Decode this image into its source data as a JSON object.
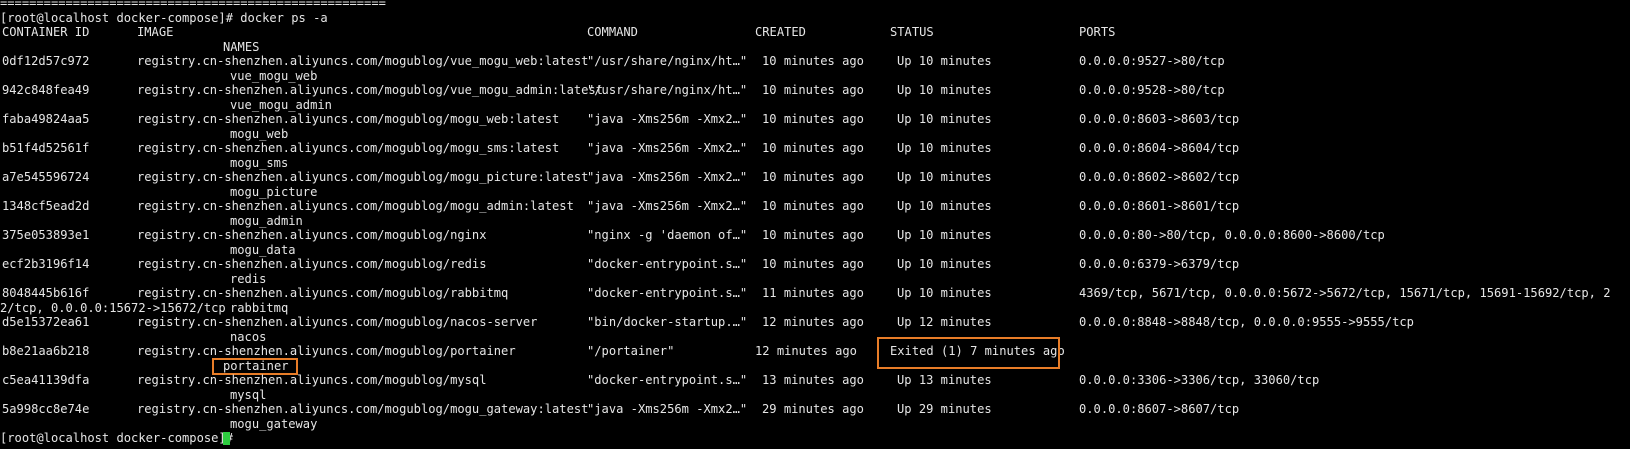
{
  "terminal": {
    "separator": "=====================================================",
    "prompt": "[root@localhost docker-compose]# docker ps -a",
    "headers": {
      "id": "CONTAINER ID",
      "image": "IMAGE",
      "command": "COMMAND",
      "created": "CREATED",
      "status": "STATUS",
      "ports": "PORTS",
      "names": "NAMES"
    },
    "rows": [
      {
        "id": "0df12d57c972",
        "image": "registry.cn-shenzhen.aliyuncs.com/mogublog/vue_mogu_web:latest",
        "command": "\"/usr/share/nginx/ht…\"",
        "created": "10 minutes ago",
        "status": "Up 10 minutes",
        "ports": "0.0.0.0:9527->80/tcp",
        "name": "vue_mogu_web"
      },
      {
        "id": "942c848fea49",
        "image": "registry.cn-shenzhen.aliyuncs.com/mogublog/vue_mogu_admin:latest",
        "command": "\"/usr/share/nginx/ht…\"",
        "created": "10 minutes ago",
        "status": "Up 10 minutes",
        "ports": "0.0.0.0:9528->80/tcp",
        "name": "vue_mogu_admin"
      },
      {
        "id": "faba49824aa5",
        "image": "registry.cn-shenzhen.aliyuncs.com/mogublog/mogu_web:latest",
        "command": "\"java -Xms256m -Xmx2…\"",
        "created": "10 minutes ago",
        "status": "Up 10 minutes",
        "ports": "0.0.0.0:8603->8603/tcp",
        "name": "mogu_web"
      },
      {
        "id": "b51f4d52561f",
        "image": "registry.cn-shenzhen.aliyuncs.com/mogublog/mogu_sms:latest",
        "command": "\"java -Xms256m -Xmx2…\"",
        "created": "10 minutes ago",
        "status": "Up 10 minutes",
        "ports": "0.0.0.0:8604->8604/tcp",
        "name": "mogu_sms"
      },
      {
        "id": "a7e545596724",
        "image": "registry.cn-shenzhen.aliyuncs.com/mogublog/mogu_picture:latest",
        "command": "\"java -Xms256m -Xmx2…\"",
        "created": "10 minutes ago",
        "status": "Up 10 minutes",
        "ports": "0.0.0.0:8602->8602/tcp",
        "name": "mogu_picture"
      },
      {
        "id": "1348cf5ead2d",
        "image": "registry.cn-shenzhen.aliyuncs.com/mogublog/mogu_admin:latest",
        "command": "\"java -Xms256m -Xmx2…\"",
        "created": "10 minutes ago",
        "status": "Up 10 minutes",
        "ports": "0.0.0.0:8601->8601/tcp",
        "name": "mogu_admin"
      },
      {
        "id": "375e053893e1",
        "image": "registry.cn-shenzhen.aliyuncs.com/mogublog/nginx",
        "command": "\"nginx -g 'daemon of…\"",
        "created": "10 minutes ago",
        "status": "Up 10 minutes",
        "ports": "0.0.0.0:80->80/tcp, 0.0.0.0:8600->8600/tcp",
        "name": "mogu_data"
      },
      {
        "id": "ecf2b3196f14",
        "image": "registry.cn-shenzhen.aliyuncs.com/mogublog/redis",
        "command": "\"docker-entrypoint.s…\"",
        "created": "10 minutes ago",
        "status": "Up 10 minutes",
        "ports": "0.0.0.0:6379->6379/tcp",
        "name": "redis"
      },
      {
        "id": "8048445b616f",
        "image": "registry.cn-shenzhen.aliyuncs.com/mogublog/rabbitmq",
        "command": "\"docker-entrypoint.s…\"",
        "created": "11 minutes ago",
        "status": "Up 10 minutes",
        "ports": "4369/tcp, 5671/tcp, 0.0.0.0:5672->5672/tcp, 15671/tcp, 15691-15692/tcp, 2",
        "ports_wrap": "2/tcp, 0.0.0.0:15672->15672/tcp",
        "name": "rabbitmq"
      },
      {
        "id": "d5e15372ea61",
        "image": "registry.cn-shenzhen.aliyuncs.com/mogublog/nacos-server",
        "command": "\"bin/docker-startup.…\"",
        "created": "12 minutes ago",
        "status": "Up 12 minutes",
        "ports": "0.0.0.0:8848->8848/tcp, 0.0.0.0:9555->9555/tcp",
        "name": "nacos"
      },
      {
        "id": "b8e21aa6b218",
        "image": "registry.cn-shenzhen.aliyuncs.com/mogublog/portainer",
        "command": "\"/portainer\"",
        "created": "12 minutes ago",
        "status": "Exited (1) 7 minutes ago",
        "ports": "",
        "name": "portainer"
      },
      {
        "id": "c5ea41139dfa",
        "image": "registry.cn-shenzhen.aliyuncs.com/mogublog/mysql",
        "command": "\"docker-entrypoint.s…\"",
        "created": "13 minutes ago",
        "status": "Up 13 minutes",
        "ports": "0.0.0.0:3306->3306/tcp, 33060/tcp",
        "name": "mysql"
      },
      {
        "id": "5a998cc8e74e",
        "image": "registry.cn-shenzhen.aliyuncs.com/mogublog/mogu_gateway:latest",
        "command": "\"java -Xms256m -Xmx2…\"",
        "created": "29 minutes ago",
        "status": "Up 29 minutes",
        "ports": "0.0.0.0:8607->8607/tcp",
        "name": "mogu_gateway"
      }
    ],
    "last_prompt": "[root@localhost docker-compose]# "
  },
  "colors": {
    "background": "#000000",
    "text": "#e6e6e6",
    "highlight": "#e87d28",
    "cursor": "#2ecc40"
  }
}
